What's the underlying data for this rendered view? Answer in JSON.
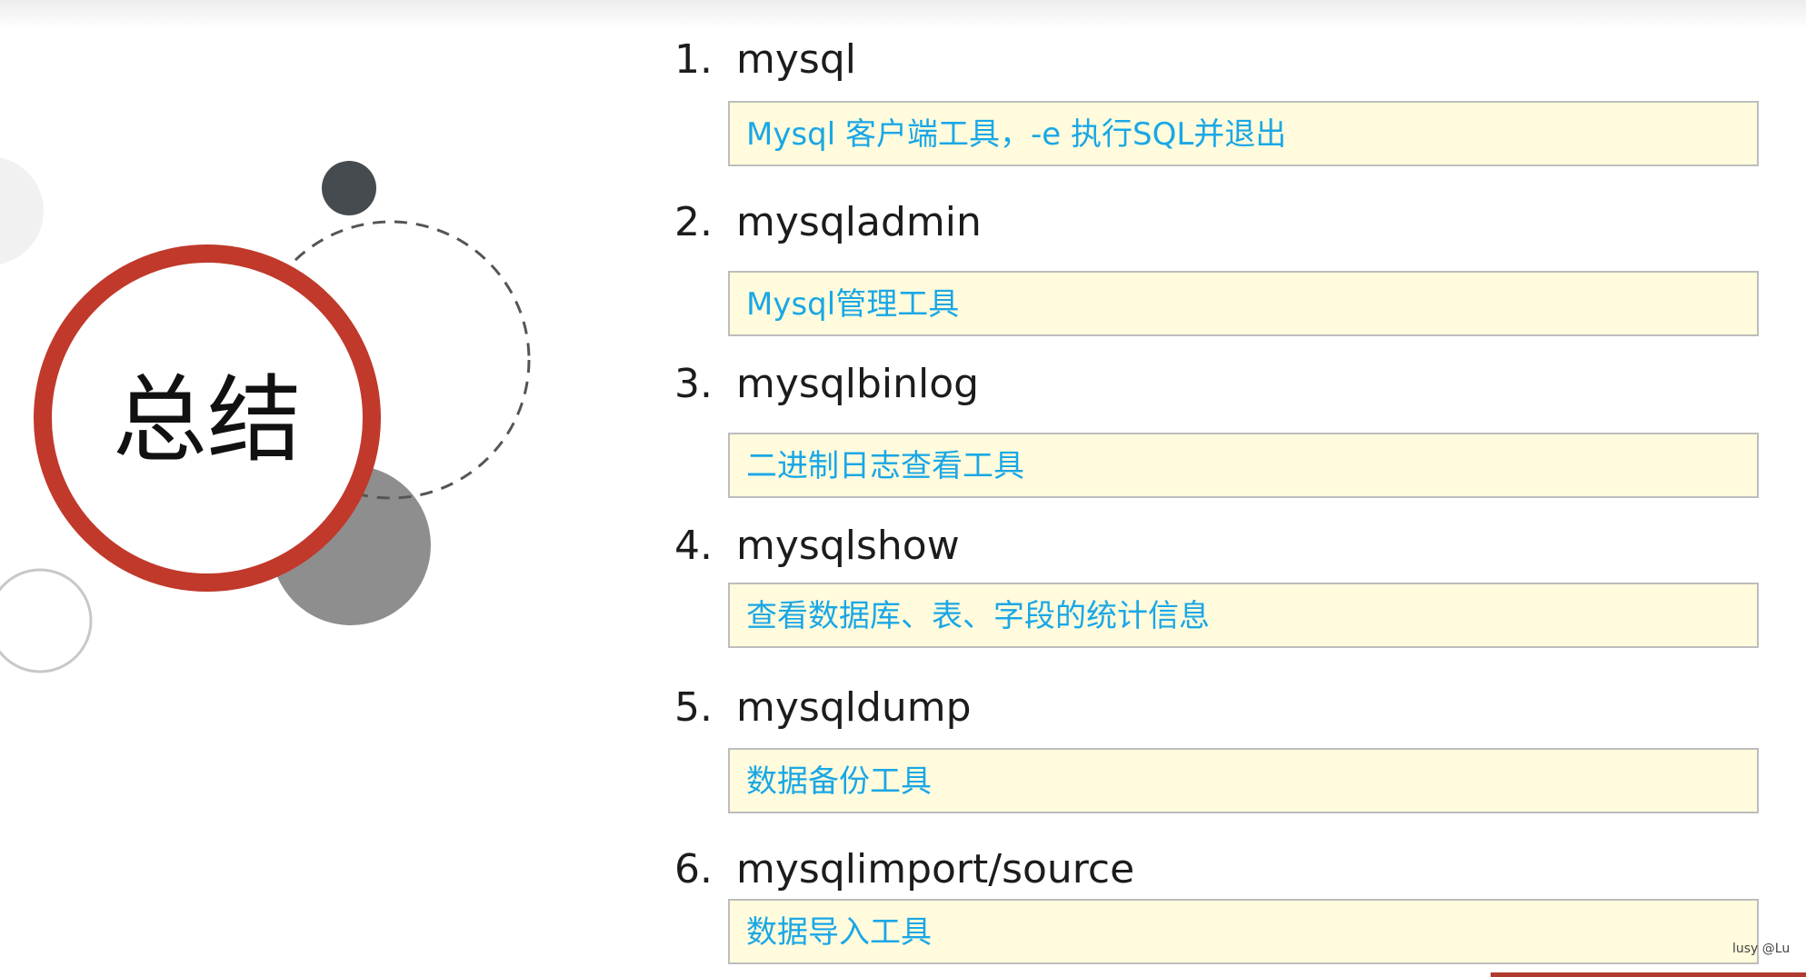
{
  "slide": {
    "title": "总结",
    "items": [
      {
        "number": "1.",
        "command": "mysql",
        "description": "Mysql 客户端工具，-e 执行SQL并退出"
      },
      {
        "number": "2.",
        "command": "mysqladmin",
        "description": "Mysql管理工具"
      },
      {
        "number": "3.",
        "command": "mysqlbinlog",
        "description": "二进制日志查看工具"
      },
      {
        "number": "4.",
        "command": "mysqlshow",
        "description": "查看数据库、表、字段的统计信息"
      },
      {
        "number": "5.",
        "command": "mysqldump",
        "description": "数据备份工具"
      },
      {
        "number": "6.",
        "command": "mysqlimport/source",
        "description": "数据导入工具"
      }
    ]
  },
  "watermark": "lusy @Lu",
  "colors": {
    "accent_ring": "#c0392b",
    "description_text": "#1aa7e6",
    "description_box": "#fffbdc",
    "dark_dot": "#454b4f",
    "gray_circle": "#8e8e8e"
  }
}
